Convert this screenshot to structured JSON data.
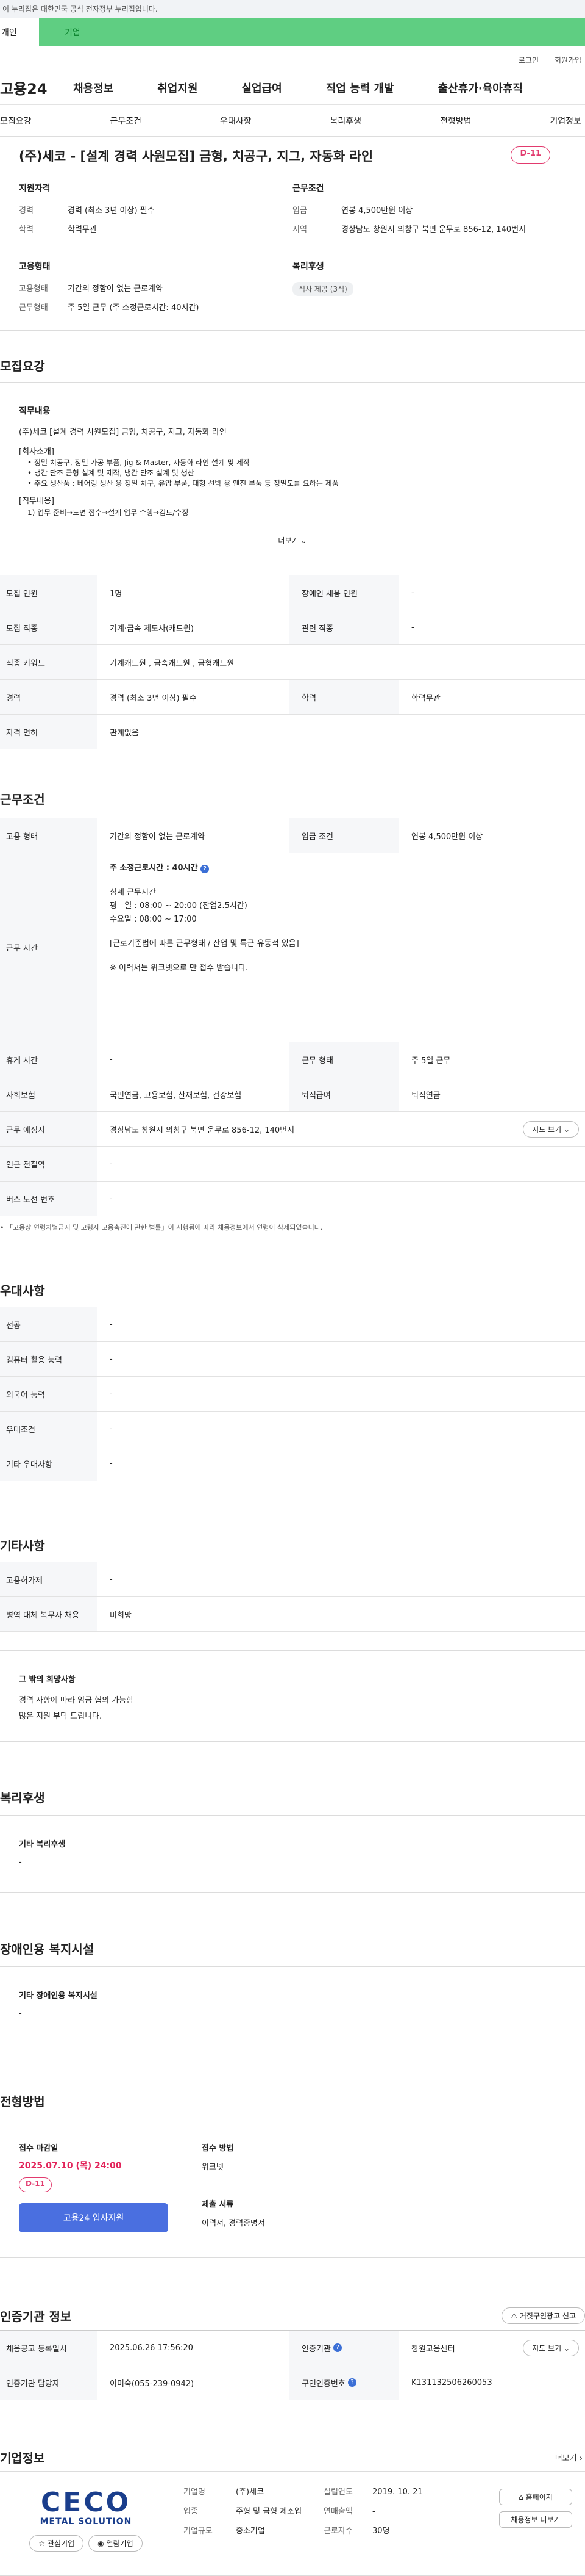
{
  "topbar": {
    "notice": "이 누리집은 대한민국 공식 전자정부 누리집입니다."
  },
  "tabs": {
    "personal": "개인",
    "company": "기업"
  },
  "util": {
    "login": "로그인",
    "signup": "회원가입"
  },
  "gnb": {
    "logo": "고용24",
    "items": [
      "채용정보",
      "취업지원",
      "실업급여",
      "직업 능력 개발",
      "출산휴가·육아휴직"
    ]
  },
  "subtabs": [
    "모집요강",
    "근무조건",
    "우대사항",
    "복리후생",
    "전형방법",
    "기업정보"
  ],
  "job": {
    "title": "(주)세코 - [설계 경력 사원모집] 금형, 치공구, 지그, 자동화 라인",
    "dday": "D-11",
    "qual_title": "지원자격",
    "career_label": "경력",
    "career": "경력 (최소 3년 이상) 필수",
    "edu_label": "학력",
    "edu": "학력무관",
    "cond_title": "근무조건",
    "wage_label": "임금",
    "wage": "연봉 4,500만원 이상",
    "area_label": "지역",
    "area": "경상남도 창원시 의창구 북면 운무로 856-12, 140번지",
    "emp_title": "고용형태",
    "emptype_label": "고용형태",
    "emptype": "기간의 정함이 없는 근로계약",
    "worktype_label": "근무형태",
    "worktype": "주 5일 근무 (주 소정근로시간: 40시간)",
    "welfare_title": "복리후생",
    "welfare_chip": "식사 제공 (3식)"
  },
  "recruit": {
    "title": "모집요강",
    "duty_title": "직무내용",
    "duty_line": "(주)세코 [설계 경력 사원모집] 금형, 치공구, 지그, 자동화 라인",
    "company_intro": "[회사소개]",
    "bullets": [
      "정밀 치공구, 정밀 가공 부품, Jig & Master, 자동화 라인 설계 및 제작",
      "냉간 단조 금형 설계 및 제작, 냉간 단조 설계 및 생산",
      "주요 생산품 : 베어링 생산 용 정밀 치구, 유압 부품, 대형 선박 용 엔진 부품 등 정밀도를 요하는 제품"
    ],
    "duty_intro": "[직무내용]",
    "duty_1": "1) 업무 준비→도면 접수→설계 업무 수행→검토/수정",
    "more": "더보기",
    "table": [
      {
        "k1": "모집 인원",
        "v1": "1명",
        "k2": "장애인 채용 인원",
        "v2": "-"
      },
      {
        "k1": "모집 직종",
        "v1": "기계·금속 제도사(캐드원)",
        "k2": "관련 직종",
        "v2": "-"
      },
      {
        "k1": "직종 키워드",
        "v1": "기계캐드원 , 금속캐드원 , 금형캐드원",
        "k2": "",
        "v2": ""
      },
      {
        "k1": "경력",
        "v1": "경력 (최소 3년 이상) 필수",
        "k2": "학력",
        "v2": "학력무관"
      },
      {
        "k1": "자격 면허",
        "v1": "관계없음",
        "k2": "",
        "v2": ""
      }
    ]
  },
  "work": {
    "title": "근무조건",
    "emptype_k": "고용 형태",
    "emptype_v": "기간의 정함이 없는 근로계약",
    "wage_k": "임금 조건",
    "wage_v": "연봉 4,500만원 이상",
    "hours_k": "근무 시간",
    "hours_weekly": "주 소정근로시간 : 40시간",
    "hours_detail_title": "상세 근무시간",
    "hours_weekday": "평   일 : 08:00 ~ 20:00 (잔업2.5시간)",
    "hours_wed": "수요일 : 08:00 ~ 17:00",
    "hours_note1": "[근로기준법에 따른 근무형태 / 잔업 및 특근 유동적 있음]",
    "hours_note2": "※ 이력서는 워크넷으로 만 접수 받습니다.",
    "rest_k": "휴게 시간",
    "rest_v": "-",
    "form_k": "근무 형태",
    "form_v": "주 5일 근무",
    "ins_k": "사회보험",
    "ins_v": "국민연금, 고용보험, 산재보험, 건강보험",
    "sev_k": "퇴직급여",
    "sev_v": "퇴직연금",
    "place_k": "근무 예정지",
    "place_v": "경상남도 창원시 의창구 북면 운무로 856-12, 140번지",
    "map_btn": "지도 보기",
    "subway_k": "인근 전철역",
    "subway_v": "-",
    "bus_k": "버스 노선 번호",
    "bus_v": "-",
    "footnote": "「고용상 연령차별금지 및 고령자 고용촉진에 관한 법률」이 시행됨에 따라 채용정보에서 연령이 삭제되었습니다."
  },
  "pref": {
    "title": "우대사항",
    "rows": [
      {
        "k": "전공",
        "v": "-"
      },
      {
        "k": "컴퓨터 활용 능력",
        "v": "-"
      },
      {
        "k": "외국어 능력",
        "v": "-"
      },
      {
        "k": "우대조건",
        "v": "-"
      },
      {
        "k": "기타 우대사항",
        "v": "-"
      }
    ]
  },
  "etc": {
    "title": "기타사항",
    "rows": [
      {
        "k": "고용허가제",
        "v": "-"
      },
      {
        "k": "병역 대체 복무자 채용",
        "v": "비희망"
      }
    ],
    "wish_title": "그 밖의 희망사항",
    "wish_1": "경력 사항에 따라 임금 협의 가능함",
    "wish_2": "많은 지원 부탁 드립니다."
  },
  "welfare": {
    "title": "복리후생",
    "sub": "기타 복리후생",
    "val": "-"
  },
  "disabled": {
    "title": "장애인용 복지시설",
    "sub": "기타 장애인용 복지시설",
    "val": "-"
  },
  "select": {
    "title": "전형방법",
    "deadline_label": "접수 마감일",
    "deadline": "2025.07.10 (목) 24:00",
    "dday": "D-11",
    "apply_btn": "고용24 입사지원",
    "method_label": "접수 방법",
    "method": "워크넷",
    "docs_label": "제출 서류",
    "docs": "이력서, 경력증명서"
  },
  "agency": {
    "title": "인증기관 정보",
    "report_btn": "거짓구인광고 신고",
    "reg_k": "채용공고 등록일시",
    "reg_v": "2025.06.26 17:56:20",
    "org_k": "인증기관",
    "org_v": "창원고용센터",
    "map_btn": "지도 보기",
    "mgr_k": "인증기관 담당자",
    "mgr_v": "이미숙(055-239-0942)",
    "no_k": "구인인증번호",
    "no_v": "K131132506260053"
  },
  "company": {
    "title": "기업정보",
    "more": "더보기",
    "logo_top": "CECO",
    "logo_bottom": "METAL SOLUTION",
    "fav_btn": "관심기업",
    "follow_btn": "열람기업",
    "name_k": "기업명",
    "name_v": "(주)세코",
    "industry_k": "업종",
    "industry_v": "주형 및 금형 제조업",
    "size_k": "기업규모",
    "size_v": "중소기업",
    "founded_k": "설립연도",
    "founded_v": "2019. 10. 21",
    "sales_k": "연매출액",
    "sales_v": "-",
    "emp_k": "근로자수",
    "emp_v": "30명",
    "home_btn": "홈페이지",
    "jobs_btn": "채용정보 더보기"
  }
}
